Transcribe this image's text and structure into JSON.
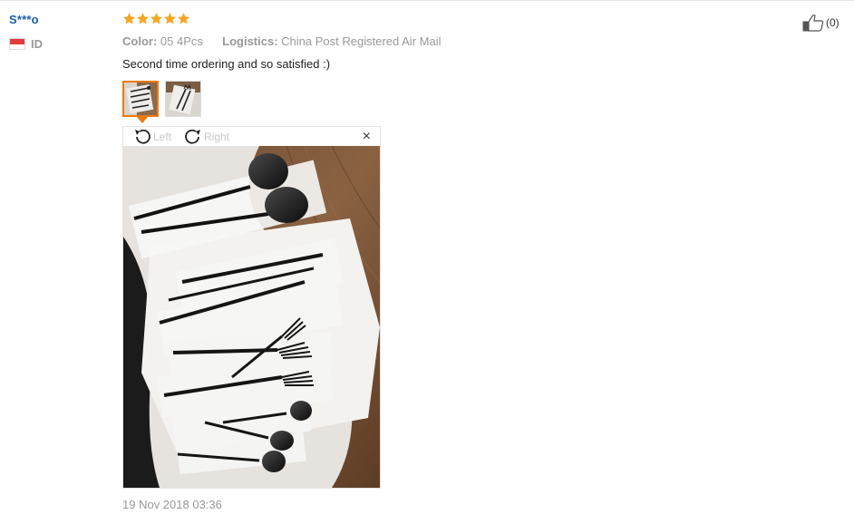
{
  "review": {
    "user_name": "S***o",
    "country_code": "ID",
    "rating": 5,
    "color_label": "Color:",
    "color_value": "05 4Pcs",
    "logistics_label": "Logistics:",
    "logistics_value": "China Post Registered Air Mail",
    "text": "Second time ordering and so satisfied :)",
    "timestamp": "19 Nov 2018 03:36",
    "helpful_count": "(0)"
  },
  "viewer": {
    "rotate_left_label": "Left",
    "rotate_right_label": "Right",
    "close_symbol": "×"
  },
  "icons": {
    "star": "star-icon",
    "thumbs_up": "thumbs-up-icon",
    "rotate_left": "rotate-left-icon",
    "rotate_right": "rotate-right-icon",
    "close": "close-icon",
    "flag": "flag-icon"
  },
  "colors": {
    "user_name": "#1a5ca8",
    "star": "#f5a623",
    "thumb_active_border": "#e97b10",
    "meta_text": "#999999",
    "body_text": "#222222"
  }
}
